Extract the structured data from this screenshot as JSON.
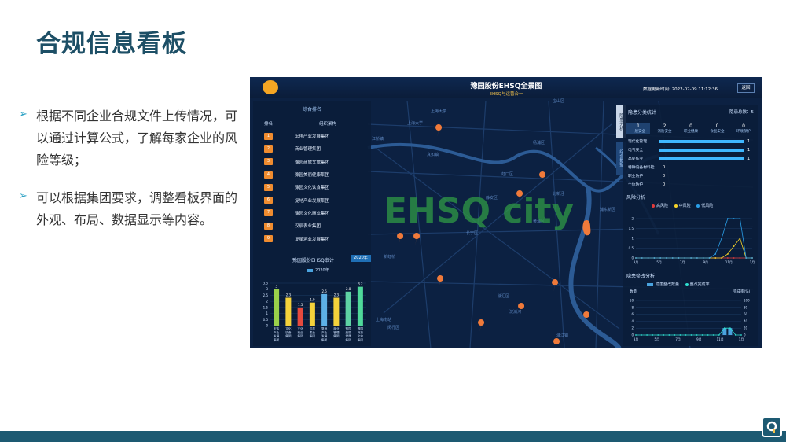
{
  "slide": {
    "title": "合规信息看板",
    "bullets": [
      "根据不同企业合规文件上传情况，可以通过计算公式，了解每家企业的风险等级；",
      "可以根据集团要求，调整看板界面的外观、布局、数据显示等内容。"
    ]
  },
  "dashboard": {
    "title": "豫园股份EHSQ全景图",
    "subtitle": "EHSQ与运营合一",
    "time_label": "数据更新时间:",
    "time_value": "2022-02-09 11:12:36",
    "back_label": "返回",
    "watermark": "EHSQ city",
    "map_labels": [
      "上海大学",
      "上海大学",
      "宝山区",
      "江桥镇",
      "真如镇",
      "静安区",
      "长宁区",
      "徐汇区",
      "闵行区",
      "浦东新区",
      "黄浦区",
      "杨浦区",
      "虹口区",
      "新虹桥",
      "北新泾",
      "上海南站",
      "淀浦河",
      "浦江镇"
    ],
    "ranking": {
      "title": "综合排名",
      "col_rank": "排名",
      "col_org": "组织架构",
      "rows": [
        {
          "rank": "1",
          "name": "宏伟产业发展集团"
        },
        {
          "rank": "2",
          "name": "商业管理集团"
        },
        {
          "rank": "3",
          "name": "豫园商旅文旅集团"
        },
        {
          "rank": "4",
          "name": "豫园美丽健康集团"
        },
        {
          "rank": "5",
          "name": "豫园文化饮食集团"
        },
        {
          "rank": "6",
          "name": "复地产业发展集团"
        },
        {
          "rank": "7",
          "name": "豫园文化商业集团"
        },
        {
          "rank": "8",
          "name": "汉辰表业集团"
        },
        {
          "rank": "9",
          "name": "复星酒业发展集团"
        }
      ]
    },
    "audit": {
      "title": "豫园股份EHSQ审计",
      "year_btn": "2020年",
      "legend": "2020年"
    },
    "hazard": {
      "title": "隐患分类统计",
      "total_label": "隐患总数：",
      "total_value": "5",
      "tab_vertical": "隐患分析",
      "tab_vertical_2": "综合数据",
      "stats": [
        {
          "n": "1",
          "l": "一般安全"
        },
        {
          "n": "2",
          "l": "消防安全"
        },
        {
          "n": "0",
          "l": "职业健康"
        },
        {
          "n": "0",
          "l": "食品安全"
        },
        {
          "n": "0",
          "l": "环境保护"
        }
      ],
      "bars": [
        {
          "label": "现代化管理",
          "value": "1",
          "pct": 1.0
        },
        {
          "label": "电气安全",
          "value": "1",
          "pct": 1.0
        },
        {
          "label": "高处作业",
          "value": "1",
          "pct": 1.0
        },
        {
          "label": "特种设备材料检",
          "value": "0",
          "pct": 0.0
        },
        {
          "label": "职业防护",
          "value": "0",
          "pct": 0.0
        },
        {
          "label": "个体防护",
          "value": "0",
          "pct": 0.0
        }
      ]
    },
    "risk": {
      "title": "风险分析",
      "legend": [
        "高风险",
        "中风险",
        "低风险"
      ]
    },
    "rectify": {
      "title": "隐患整改分析",
      "legend": [
        "隐患整改数量",
        "整改完成率"
      ],
      "y_left_label": "数量",
      "y_right_label": "完成率(%)"
    }
  },
  "chart_data": [
    {
      "type": "bar",
      "title": "豫园股份EHSQ审计",
      "categories": [
        "宏伟产业发展集团",
        "文化饮食集团",
        "文化商业集团",
        "汉辰表业集团",
        "复地产业发展集团",
        "商业管理集团",
        "豫园美丽健康集团",
        "豫园商旅文旅集团"
      ],
      "series": [
        {
          "name": "2020年",
          "values": [
            3,
            2.3,
            1.5,
            1.9,
            2.6,
            2.3,
            2.8,
            3.2
          ]
        }
      ],
      "value_labels": [
        "3",
        "2.3",
        "1.5",
        "1.9",
        "2.6",
        "2.3",
        "2.8",
        "3.2"
      ],
      "ylim": [
        0,
        3.5
      ],
      "bar_colors": [
        "#9ad04a",
        "#f4d23b",
        "#e64a3e",
        "#f4d23b",
        "#5db0e6",
        "#f4d23b",
        "#5ed2a4",
        "#4fd99a"
      ],
      "ytick_labels": [
        "0",
        "0.5",
        "1",
        "1.5",
        "2",
        "2.5",
        "3",
        "3.5"
      ]
    },
    {
      "type": "line",
      "title": "风险分析",
      "categories": [
        "3月",
        "5月",
        "7月",
        "9月",
        "11月",
        "1月"
      ],
      "x": [
        0,
        1,
        2,
        3,
        4,
        5,
        6,
        7,
        8,
        9,
        10,
        11,
        12,
        13,
        14,
        15,
        16,
        17,
        18,
        19
      ],
      "series": [
        {
          "name": "高风险",
          "color": "#e33b3b",
          "values": [
            0,
            0,
            0,
            0,
            0,
            0,
            0,
            0,
            0,
            0,
            0,
            0,
            0,
            0,
            0,
            0,
            0,
            0,
            0,
            0
          ]
        },
        {
          "name": "中风险",
          "color": "#f5d329",
          "values": [
            0,
            0,
            0,
            0,
            0,
            0,
            0,
            0,
            0,
            0,
            0,
            0,
            0,
            0,
            0,
            0.2,
            0.6,
            1,
            0,
            0
          ]
        },
        {
          "name": "低风险",
          "color": "#2a9fe8",
          "values": [
            0,
            0,
            0,
            0,
            0,
            0,
            0,
            0,
            0,
            0,
            0,
            0,
            0,
            0.2,
            1,
            2,
            2,
            2,
            0,
            0
          ]
        }
      ],
      "ylim": [
        0,
        2
      ],
      "ytick_labels": [
        "0",
        "0.5",
        "1",
        "1.5",
        "2"
      ]
    },
    {
      "type": "bar",
      "title": "隐患整改分析",
      "categories": [
        "3月",
        "5月",
        "7月",
        "9月",
        "11月",
        "1月"
      ],
      "series": [
        {
          "name": "隐患整改数量",
          "color": "#4aa3df",
          "values": [
            0,
            0,
            0,
            0,
            0,
            0,
            0,
            0,
            0,
            0,
            0,
            0,
            0,
            0,
            0,
            0,
            2,
            2,
            0,
            0
          ]
        },
        {
          "name": "整改完成率",
          "color": "#2fe0d0",
          "values": [
            0,
            0,
            0,
            0,
            0,
            0,
            0,
            0,
            0,
            0,
            0,
            0,
            0,
            0,
            0,
            0,
            20,
            20,
            0,
            0
          ]
        }
      ],
      "ylim": [
        0,
        10
      ],
      "y2lim": [
        0,
        100
      ],
      "ytick_labels": [
        "0",
        "2",
        "4",
        "6",
        "8",
        "10"
      ],
      "y2tick_labels": [
        "0",
        "20",
        "40",
        "60",
        "80",
        "100"
      ]
    }
  ]
}
